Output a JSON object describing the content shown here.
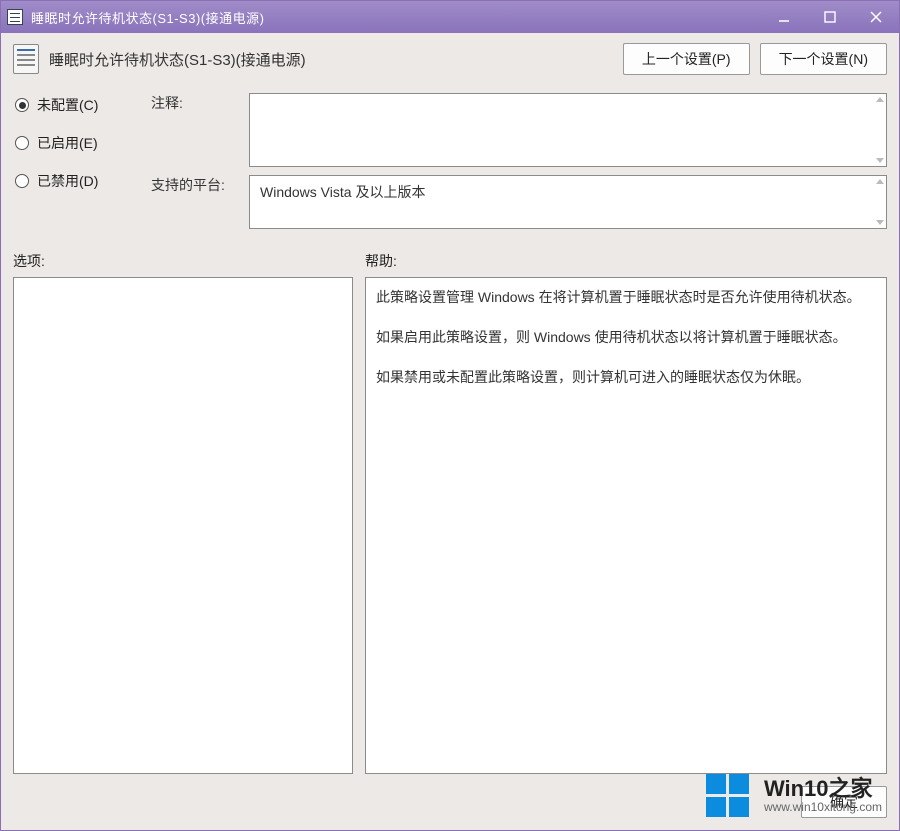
{
  "titlebar": {
    "title": "睡眠时允许待机状态(S1-S3)(接通电源)"
  },
  "header": {
    "policy_name": "睡眠时允许待机状态(S1-S3)(接通电源)",
    "prev_label": "上一个设置(P)",
    "next_label": "下一个设置(N)"
  },
  "radios": {
    "not_configured": "未配置(C)",
    "enabled": "已启用(E)",
    "disabled": "已禁用(D)",
    "selected": "not_configured"
  },
  "labels": {
    "comment": "注释:",
    "supported": "支持的平台:",
    "options": "选项:",
    "help": "帮助:"
  },
  "fields": {
    "comment_value": "",
    "supported_value": "Windows Vista 及以上版本"
  },
  "help": {
    "p1": "此策略设置管理 Windows 在将计算机置于睡眠状态时是否允许使用待机状态。",
    "p2": "如果启用此策略设置，则 Windows 使用待机状态以将计算机置于睡眠状态。",
    "p3": "如果禁用或未配置此策略设置，则计算机可进入的睡眠状态仅为休眠。"
  },
  "buttons": {
    "ok": "确定"
  },
  "watermark": {
    "brand": "Win10之家",
    "url": "www.win10xitong.com"
  }
}
